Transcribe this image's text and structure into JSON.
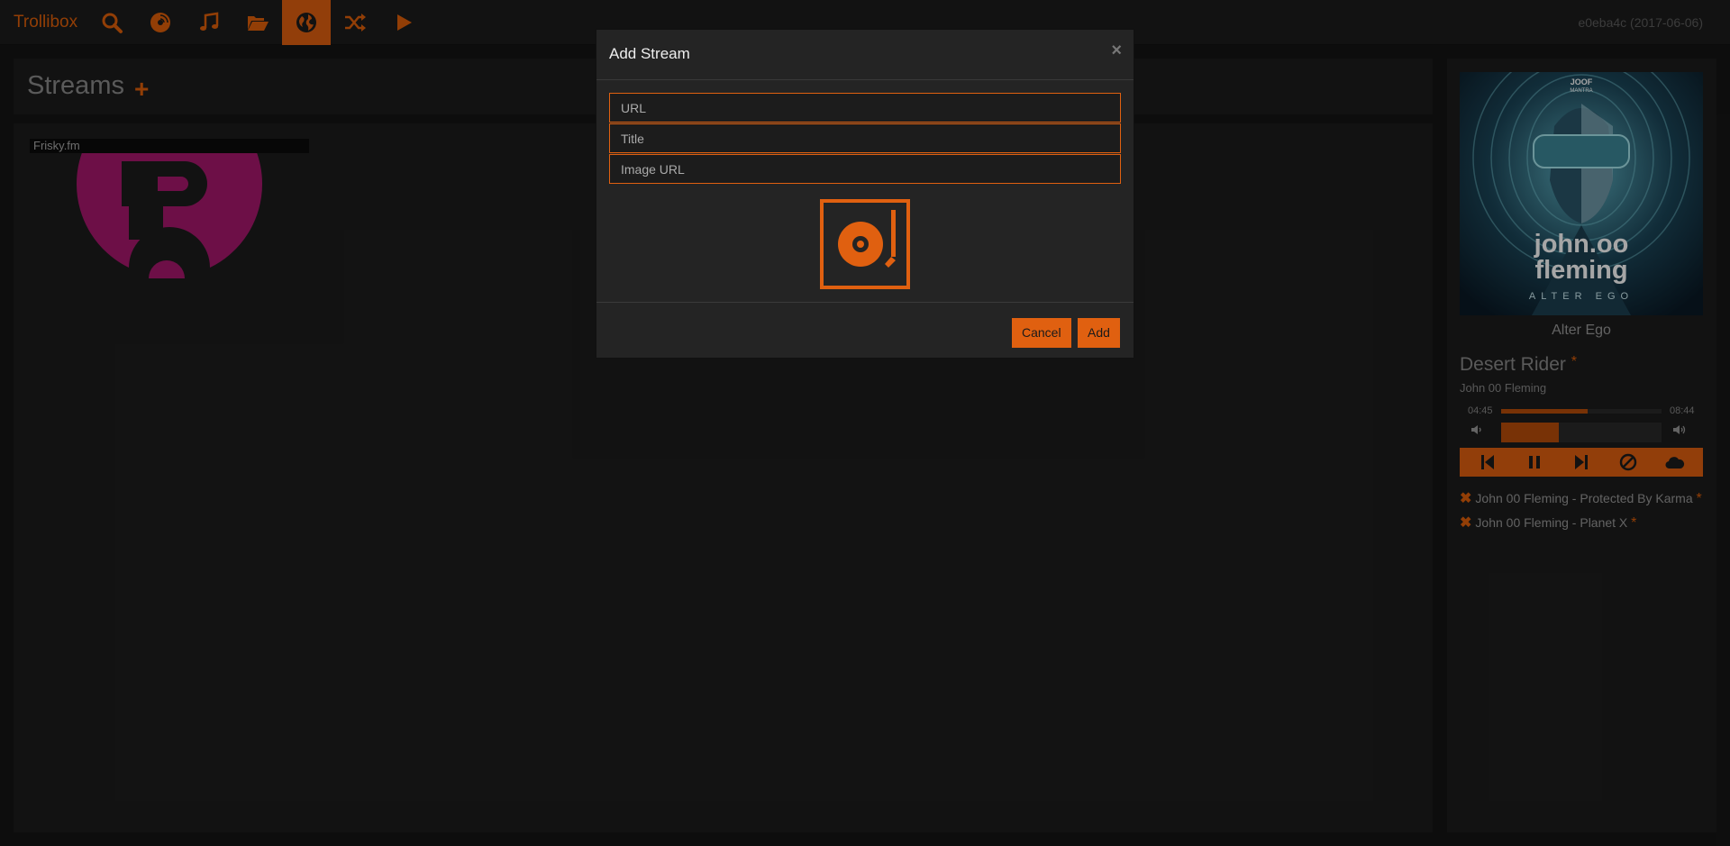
{
  "app": {
    "brand": "Trollibox",
    "version": "e0eba4c (2017-06-06)"
  },
  "nav": [
    {
      "icon": "search-icon",
      "active": false
    },
    {
      "icon": "disc-icon",
      "active": false
    },
    {
      "icon": "music-note-icon",
      "active": false
    },
    {
      "icon": "folder-open-icon",
      "active": false
    },
    {
      "icon": "globe-icon",
      "active": true
    },
    {
      "icon": "shuffle-icon",
      "active": false
    },
    {
      "icon": "play-icon",
      "active": false
    }
  ],
  "main": {
    "title": "Streams",
    "add_symbol": "+"
  },
  "streams": [
    {
      "label": "Frisky.fm"
    }
  ],
  "player": {
    "album": "Alter Ego",
    "album_art_text": {
      "line1": "JOOF",
      "line2": "MANTRA",
      "artist1": "john.oo",
      "artist2": "fleming",
      "title": "ALTER EGO"
    },
    "track": "Desert Rider",
    "star": "*",
    "artist": "John 00 Fleming",
    "elapsed": "04:45",
    "duration": "08:44",
    "progress": 0.54,
    "volume": 0.36,
    "controls": [
      "prev-icon",
      "pause-icon",
      "next-icon",
      "ban-icon",
      "cloud-icon"
    ]
  },
  "queue": [
    {
      "x": "✖",
      "text": "John 00 Fleming - Protected By Karma",
      "star": "*"
    },
    {
      "x": "✖",
      "text": "John 00 Fleming - Planet X",
      "star": "*"
    }
  ],
  "modal": {
    "title": "Add Stream",
    "close": "×",
    "url_placeholder": "URL",
    "title_placeholder": "Title",
    "image_placeholder": "Image URL",
    "cancel": "Cancel",
    "add": "Add"
  },
  "colors": {
    "accent": "#e06010",
    "background": "#151515",
    "panel": "#1d1d1d",
    "stream_logo": "#a8186e"
  }
}
